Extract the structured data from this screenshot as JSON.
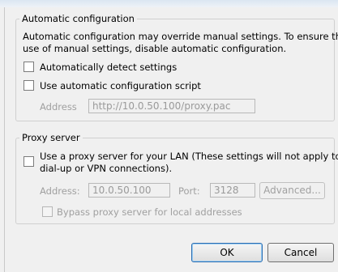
{
  "auto": {
    "legend": "Automatic configuration",
    "desc_line1": "Automatic configuration may override manual settings.  To ensure the",
    "desc_line2": "use of manual settings, disable automatic configuration.",
    "detect_label": "Automatically detect settings",
    "detect_checked": false,
    "script_label": "Use automatic configuration script",
    "script_checked": false,
    "address_label": "Address",
    "address_value": "http://10.0.50.100/proxy.pac"
  },
  "proxy": {
    "legend": "Proxy server",
    "use_label_line1": "Use a proxy server for your LAN (These settings will not apply to",
    "use_label_line2": "dial-up or VPN connections).",
    "use_checked": false,
    "address_label": "Address:",
    "address_value": "10.0.50.100",
    "port_label": "Port:",
    "port_value": "3128",
    "advanced_label": "Advanced...",
    "bypass_label": "Bypass proxy server for local addresses",
    "bypass_checked": false
  },
  "buttons": {
    "ok": "OK",
    "cancel": "Cancel"
  }
}
